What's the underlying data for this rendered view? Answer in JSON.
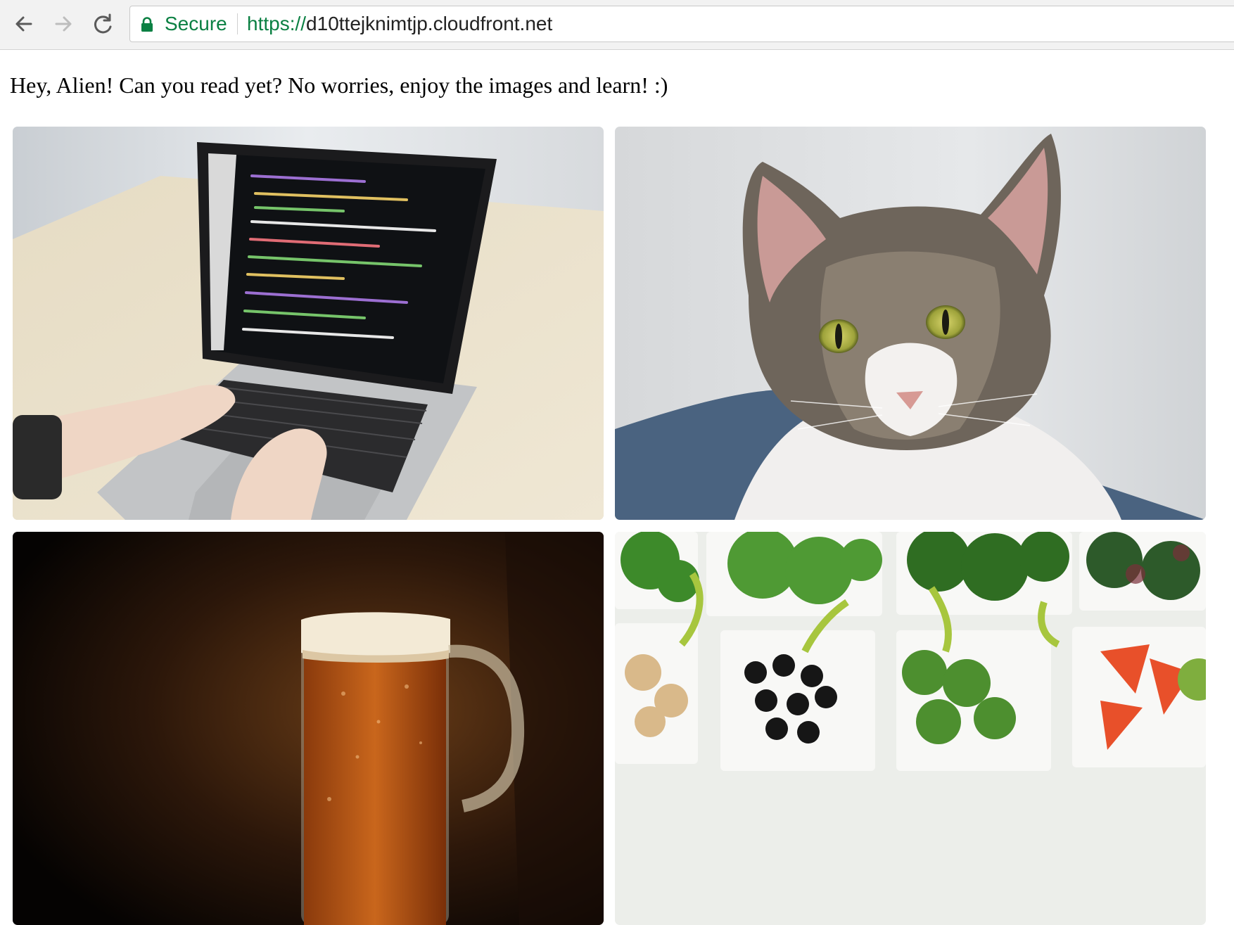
{
  "browser": {
    "security_label": "Secure",
    "url_scheme": "https://",
    "url_host": "d10ttejknimtjp.cloudfront.net",
    "secure_color": "#0b8043"
  },
  "page": {
    "greeting": "Hey, Alien! Can you read yet? No worries, enjoy the images and learn! :)",
    "images": [
      {
        "subject": "laptop-coding"
      },
      {
        "subject": "cat"
      },
      {
        "subject": "beer-mug"
      },
      {
        "subject": "salad-vegetables"
      }
    ]
  }
}
